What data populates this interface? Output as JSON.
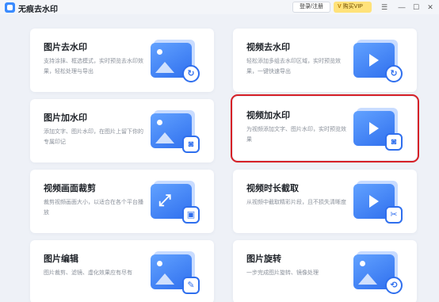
{
  "app": {
    "title": "无痕去水印"
  },
  "header": {
    "login_label": "登录/注册",
    "vip_label": "购买VIP"
  },
  "tools": [
    {
      "title": "图片去水印",
      "desc": "支持涂抹、框选模式，实时预览去水印效果，轻松处理与导出",
      "icon": "image-remove-watermark-icon"
    },
    {
      "title": "视频去水印",
      "desc": "轻松添加多组去水印区域，实时预览效果，一键快速导出",
      "icon": "video-remove-watermark-icon"
    },
    {
      "title": "图片加水印",
      "desc": "添加文字、图片水印，在图片上留下你的专属印记",
      "icon": "image-add-watermark-icon"
    },
    {
      "title": "视频加水印",
      "desc": "为视频添加文字、图片水印，实时预览效果",
      "icon": "video-add-watermark-icon"
    },
    {
      "title": "视频画面裁剪",
      "desc": "裁剪视频画面大小，以适合在各个平台播放",
      "icon": "video-crop-icon"
    },
    {
      "title": "视频时长截取",
      "desc": "从视频中截取精彩片段，且不损失清晰度",
      "icon": "video-trim-icon"
    },
    {
      "title": "图片编辑",
      "desc": "图片裁剪、滤镜、虚化效果应有尽有",
      "icon": "image-edit-icon"
    },
    {
      "title": "图片旋转",
      "desc": "一步完成图片旋转、镜像处理",
      "icon": "image-rotate-icon"
    }
  ]
}
